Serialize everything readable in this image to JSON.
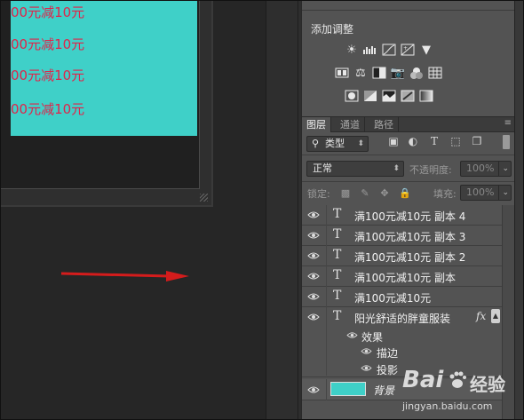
{
  "canvas": {
    "promo_lines": [
      "00元减10元",
      "00元减10元",
      "00元减10元",
      "00元减10元"
    ],
    "promo_color": "#e0244a",
    "background_color": "#3fd0c8",
    "annotation": "red-arrow"
  },
  "adjustments": {
    "title": "添加调整",
    "rows": [
      [
        "brightness-icon",
        "levels-icon",
        "curves-icon",
        "exposure-icon",
        "vibrance-icon"
      ],
      [
        "hue-saturation-icon",
        "color-balance-icon",
        "black-white-icon",
        "photo-filter-icon",
        "channel-mixer-icon",
        "color-lookup-icon"
      ],
      [
        "invert-icon",
        "posterize-icon",
        "threshold-icon",
        "selective-color-icon",
        "gradient-map-icon"
      ]
    ]
  },
  "layers_panel": {
    "tabs": [
      {
        "label": "图层",
        "active": true
      },
      {
        "label": "通道",
        "active": false
      },
      {
        "label": "路径",
        "active": false
      }
    ],
    "filter_kind": "类型",
    "blend_mode": "正常",
    "opacity_label": "不透明度:",
    "opacity_value": "100%",
    "lock_label": "锁定:",
    "fill_label": "填充:",
    "fill_value": "100%",
    "layers": [
      {
        "name": "满100元减10元 副本 4",
        "type": "text"
      },
      {
        "name": "满100元减10元 副本 3",
        "type": "text"
      },
      {
        "name": "满100元减10元 副本 2",
        "type": "text"
      },
      {
        "name": "满100元减10元 副本",
        "type": "text"
      },
      {
        "name": "满100元减10元",
        "type": "text"
      },
      {
        "name": "阳光舒适的胖童服装",
        "type": "text",
        "fx": "fx"
      }
    ],
    "effects_label": "效果",
    "effects": [
      "描边",
      "投影"
    ],
    "background_layer": "背景"
  },
  "watermark": {
    "brand": "Bai",
    "brand_suffix": "经验",
    "url": "jingyan.baidu.com"
  }
}
